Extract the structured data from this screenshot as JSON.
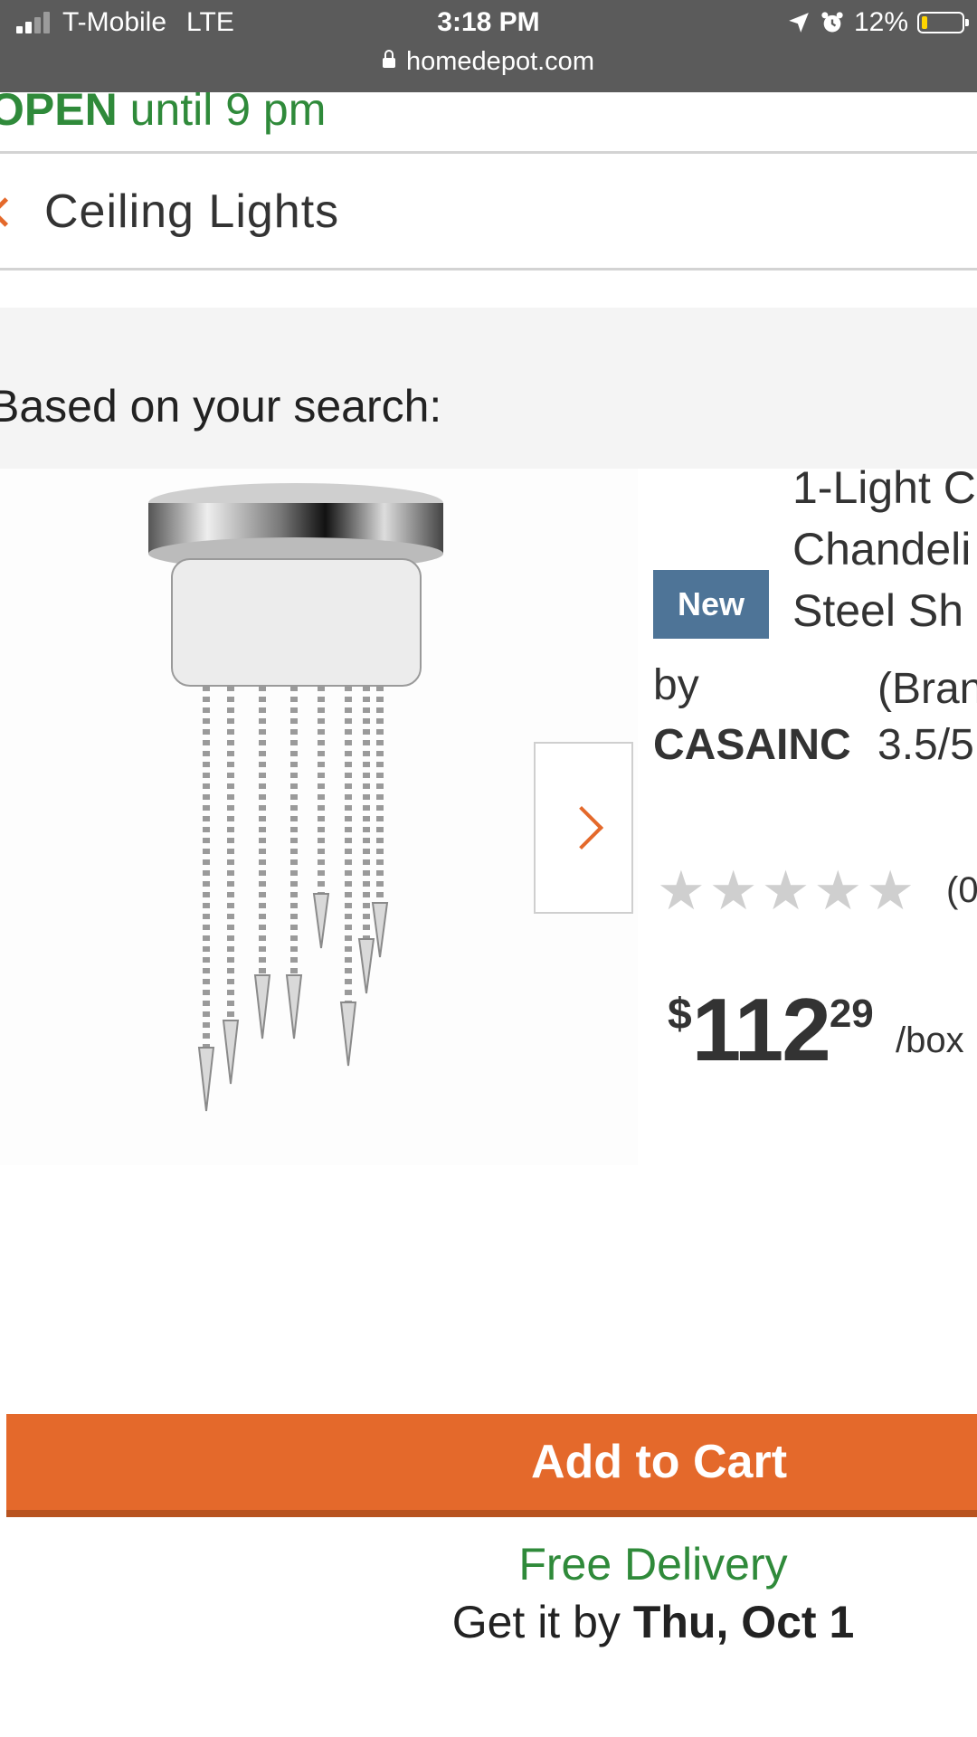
{
  "status_bar": {
    "carrier": "T-Mobile",
    "network": "LTE",
    "time": "3:18 PM",
    "battery": "12%",
    "url": "homedepot.com"
  },
  "store": {
    "open_prefix": "OPEN",
    "open_suffix": "until 9 pm"
  },
  "breadcrumb": {
    "label": "Ceiling Lights"
  },
  "recommendations": {
    "heading": "Based on your search:"
  },
  "product": {
    "badge": "New",
    "title_lines": [
      "1-Light C",
      "Chandeli",
      "Steel Sh"
    ],
    "by_label": "by",
    "brand": "CASAINC",
    "brand_side_1": "(Bran",
    "brand_side_2": "3.5/5",
    "rating": 0,
    "reviews": "(0",
    "price": {
      "currency": "$",
      "dollars": "112",
      "cents": "29",
      "unit": "/box"
    }
  },
  "actions": {
    "add_to_cart": "Add to Cart"
  },
  "delivery": {
    "label": "Free Delivery",
    "get_it_by": "Get it by",
    "date": "Thu, Oct 1"
  },
  "colors": {
    "accent": "#e4692b",
    "green": "#2f8a3a",
    "badge": "#4e7497"
  }
}
